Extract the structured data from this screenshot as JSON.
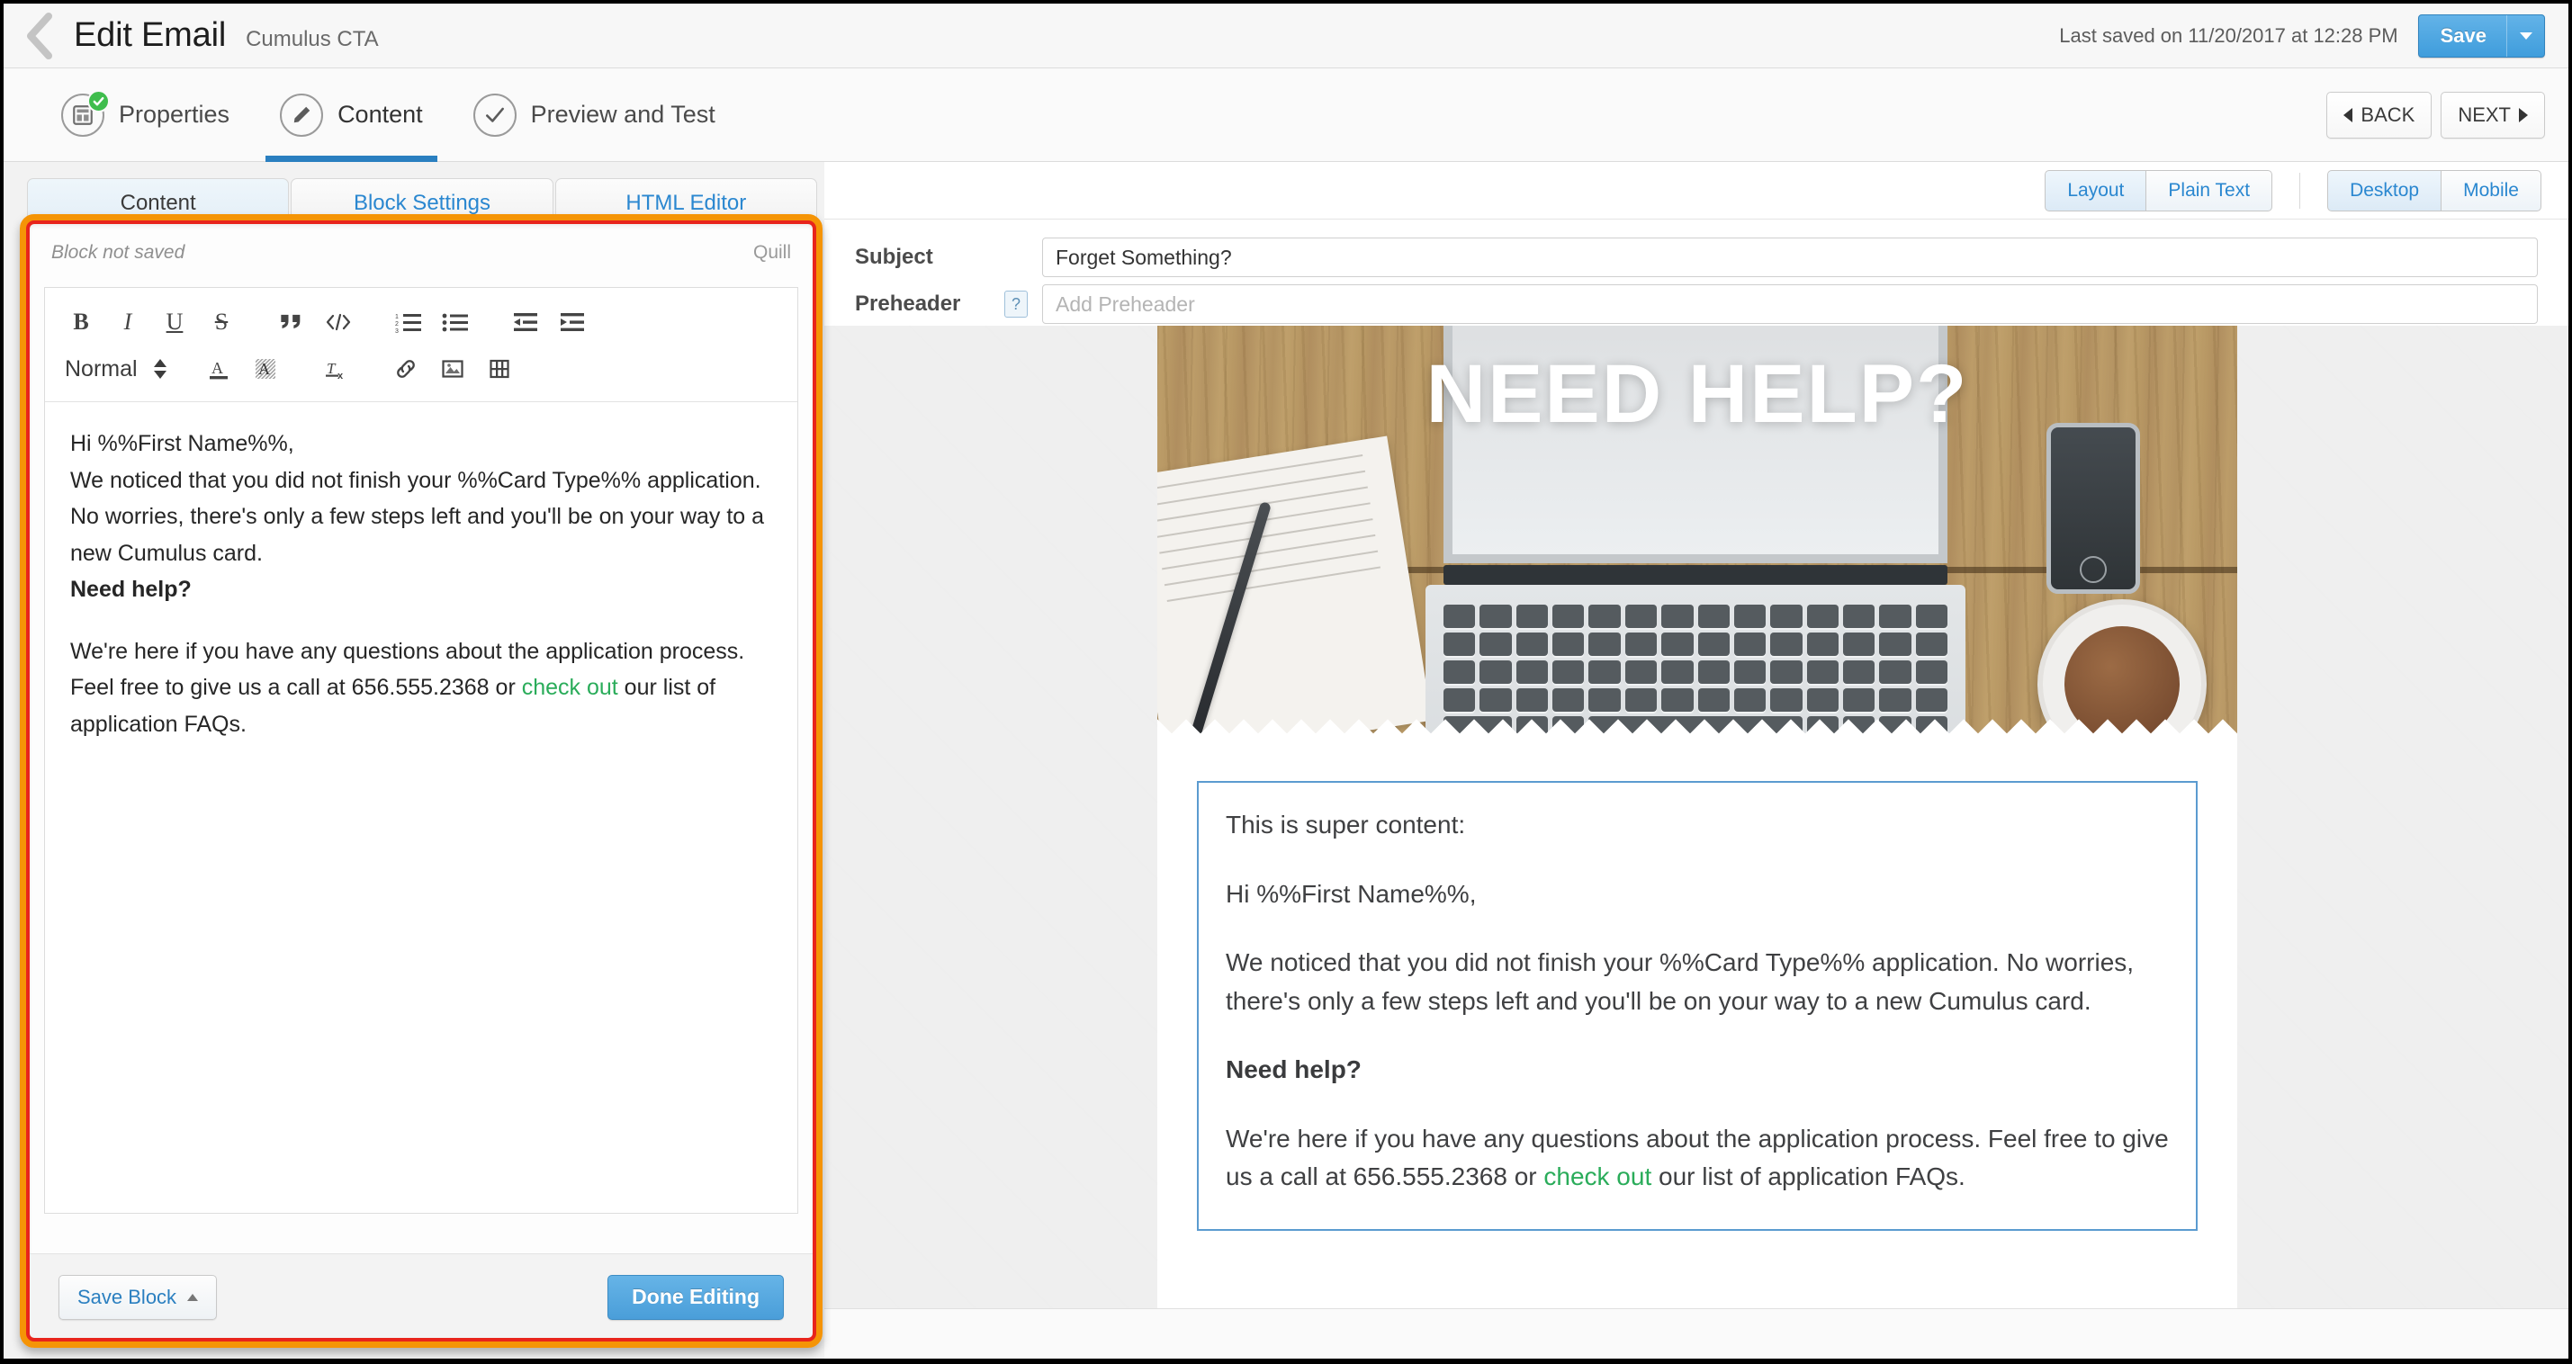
{
  "header": {
    "back_icon": "chevron-left-icon",
    "title": "Edit Email",
    "subtitle": "Cumulus CTA",
    "last_saved": "Last saved on 11/20/2017 at 12:28 PM",
    "save_label": "Save",
    "save_caret_icon": "caret-down-icon"
  },
  "steps": [
    {
      "label": "Properties",
      "icon": "properties-icon",
      "complete": true
    },
    {
      "label": "Content",
      "icon": "pencil-icon",
      "active": true
    },
    {
      "label": "Preview and Test",
      "icon": "check-icon"
    }
  ],
  "step_nav": {
    "back_label": "BACK",
    "next_label": "NEXT"
  },
  "editor": {
    "tabs": [
      {
        "label": "Content",
        "active": true
      },
      {
        "label": "Block Settings",
        "active": false
      },
      {
        "label": "HTML Editor",
        "active": false
      }
    ],
    "block_status": "Block not saved",
    "engine_label": "Quill",
    "toolbar_row1": [
      {
        "name": "bold-icon",
        "glyph": "B"
      },
      {
        "name": "italic-icon",
        "glyph": "I"
      },
      {
        "name": "underline-icon",
        "glyph": "U"
      },
      {
        "name": "strikethrough-icon",
        "glyph": "S"
      },
      {
        "name": "blockquote-icon",
        "glyph": "”"
      },
      {
        "name": "code-icon",
        "glyph": "</>"
      },
      {
        "name": "ordered-list-icon",
        "glyph": ""
      },
      {
        "name": "bullet-list-icon",
        "glyph": ""
      },
      {
        "name": "outdent-icon",
        "glyph": ""
      },
      {
        "name": "indent-icon",
        "glyph": ""
      }
    ],
    "format_select": "Normal",
    "toolbar_row2": [
      {
        "name": "text-color-icon",
        "glyph": "A"
      },
      {
        "name": "background-color-icon",
        "glyph": "A"
      },
      {
        "name": "clear-format-icon",
        "glyph": "Tx"
      },
      {
        "name": "link-icon",
        "glyph": ""
      },
      {
        "name": "image-icon",
        "glyph": ""
      },
      {
        "name": "video-icon",
        "glyph": ""
      }
    ],
    "content": {
      "greeting": "Hi %%First Name%%,",
      "paragraph1": "We noticed that you did not finish your %%Card Type%% application. No worries, there's only a few steps left and you'll be on your way to a new Cumulus card.",
      "heading": "Need help?",
      "paragraph2_before": "We're here if you have any questions about the application process. Feel free to give us a call at 656.555.2368 or ",
      "paragraph2_link": "check out",
      "paragraph2_after": " our list of application FAQs."
    },
    "save_block_label": "Save Block",
    "done_editing_label": "Done Editing"
  },
  "preview": {
    "view_toggle": [
      {
        "label": "Layout",
        "selected": true
      },
      {
        "label": "Plain Text",
        "selected": false
      }
    ],
    "device_toggle": [
      {
        "label": "Desktop",
        "selected": true
      },
      {
        "label": "Mobile",
        "selected": false
      }
    ],
    "subject_label": "Subject",
    "subject_value": "Forget Something?",
    "preheader_label": "Preheader",
    "preheader_help_icon": "question-mark-icon",
    "preheader_placeholder": "Add Preheader",
    "hero_title": "NEED HELP?",
    "email": {
      "intro": "This is super content:",
      "greeting": "Hi %%First Name%%,",
      "paragraph1": "We noticed that you did not finish your %%Card Type%% application. No worries, there's only a few steps left and you'll be on your way to a new Cumulus card.",
      "heading": "Need help?",
      "paragraph2_before": "We're here if you have any questions about the application process. Feel free to give us a call at 656.555.2368 or ",
      "paragraph2_link": "check out",
      "paragraph2_after": " our list of application FAQs."
    }
  },
  "colors": {
    "accent_blue": "#2a7fc0",
    "save_blue": "#4a9ed9",
    "highlight_orange": "#f59406",
    "highlight_red": "#e8241c",
    "link_green": "#2aac5a",
    "complete_green": "#3fbd4d",
    "preview_border_blue": "#5b9bd0"
  }
}
